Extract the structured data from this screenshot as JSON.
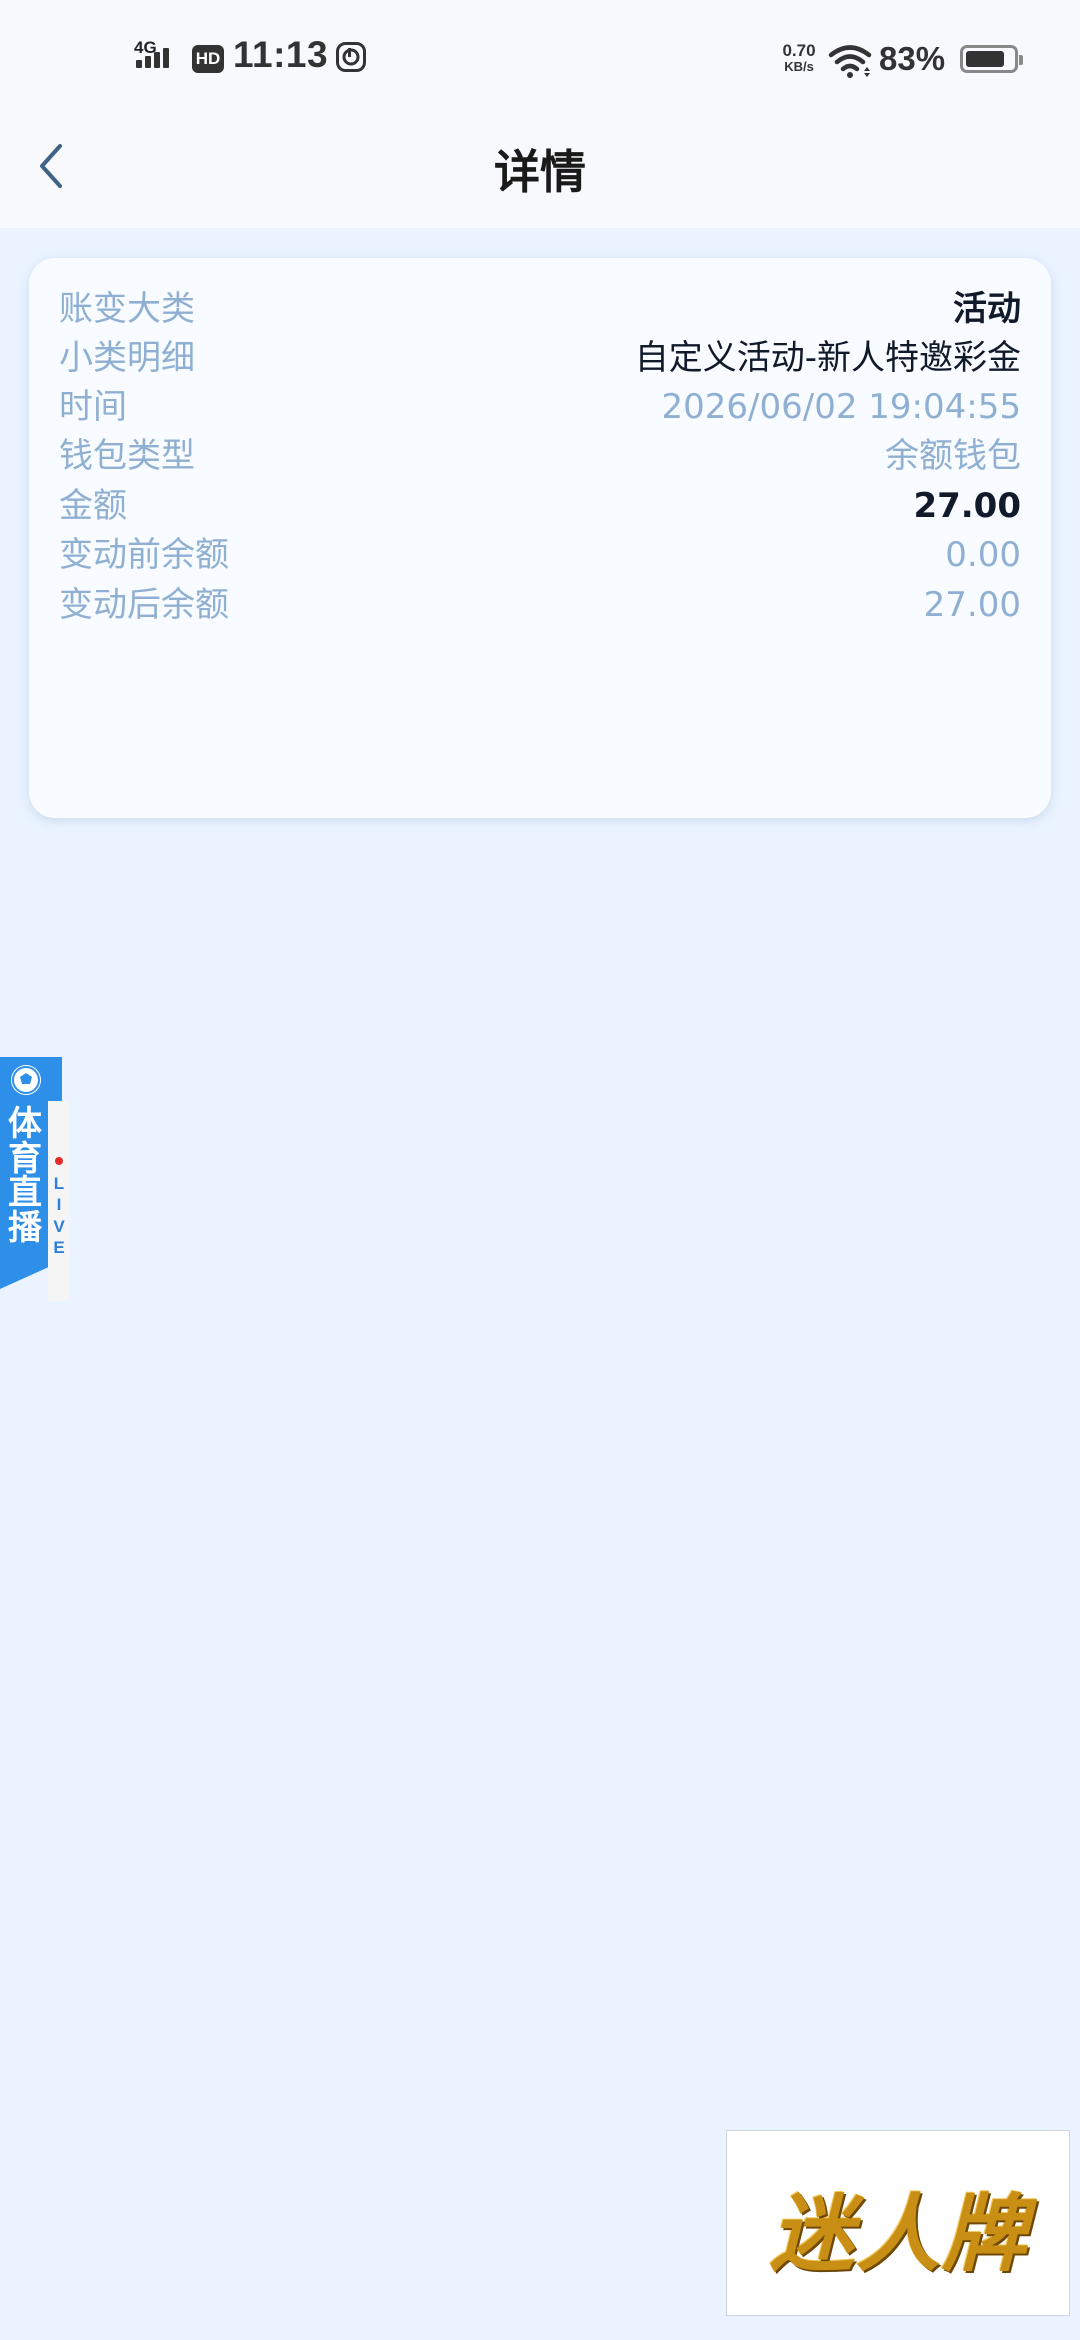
{
  "status_bar": {
    "network": "4G",
    "hd_badge": "HD",
    "time": "11:13",
    "speed_value": "0.70",
    "speed_unit": "KB/s",
    "battery_percent": "83%",
    "battery_level": 0.83
  },
  "header": {
    "title": "详情",
    "back_icon": "chevron-left-icon"
  },
  "details": [
    {
      "label": "账变大类",
      "value": "活动",
      "style": "strong"
    },
    {
      "label": "小类明细",
      "value": "自定义活动-新人特邀彩金",
      "style": "dark"
    },
    {
      "label": "时间",
      "value": "2026/06/02 19:04:55",
      "style": "muted"
    },
    {
      "label": "钱包类型",
      "value": "余额钱包",
      "style": "muted"
    },
    {
      "label": "金额",
      "value": "27.00",
      "style": "strong"
    },
    {
      "label": "变动前余额",
      "value": "0.00",
      "style": "muted"
    },
    {
      "label": "变动后余额",
      "value": "27.00",
      "style": "muted"
    }
  ],
  "sports_tab": {
    "chars": [
      "体",
      "育",
      "直",
      "播"
    ],
    "live_letters": [
      "L",
      "I",
      "V",
      "E"
    ],
    "icon": "soccer-ball-icon"
  },
  "ad": {
    "text": "迷人牌"
  },
  "colors": {
    "background": "#eaf3ff",
    "label": "#8fb0d2",
    "value_dark": "#111a2b",
    "sports_blue": "#2d8fe8"
  }
}
